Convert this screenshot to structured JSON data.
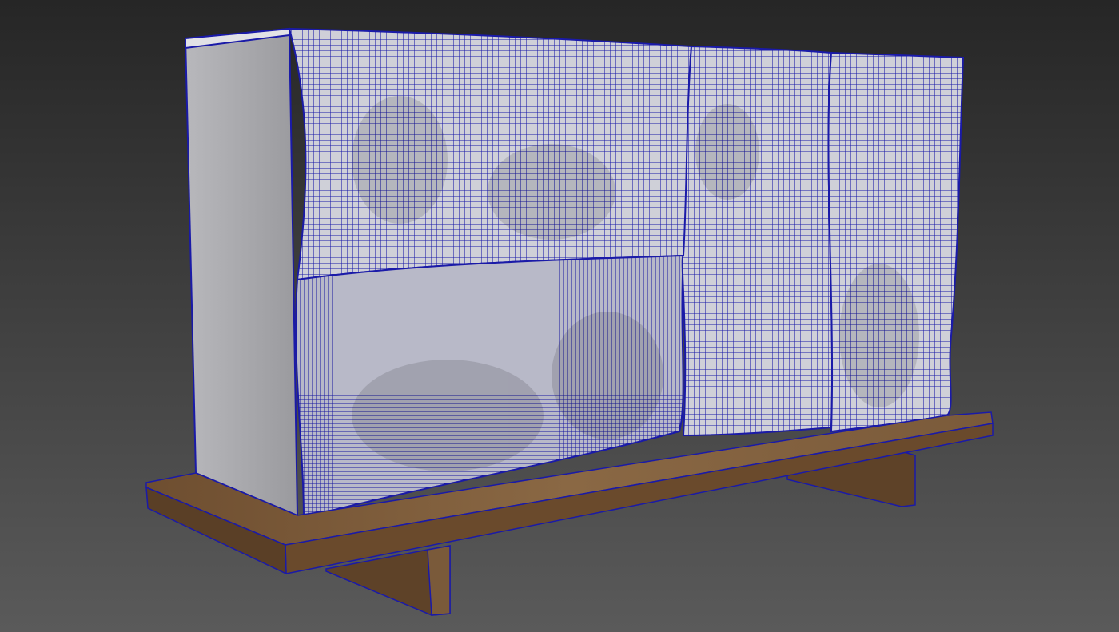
{
  "scene": {
    "subject": "wireframe-cabinet-render",
    "colors": {
      "background_top": "#262626",
      "background_bottom": "#5a5a5a",
      "wire": "#1a1aa8",
      "surface": "#d2d2d6",
      "side_panel": "#a9a9ad",
      "wood": "#7a5a3a",
      "wood_dark": "#5a3f26"
    }
  }
}
